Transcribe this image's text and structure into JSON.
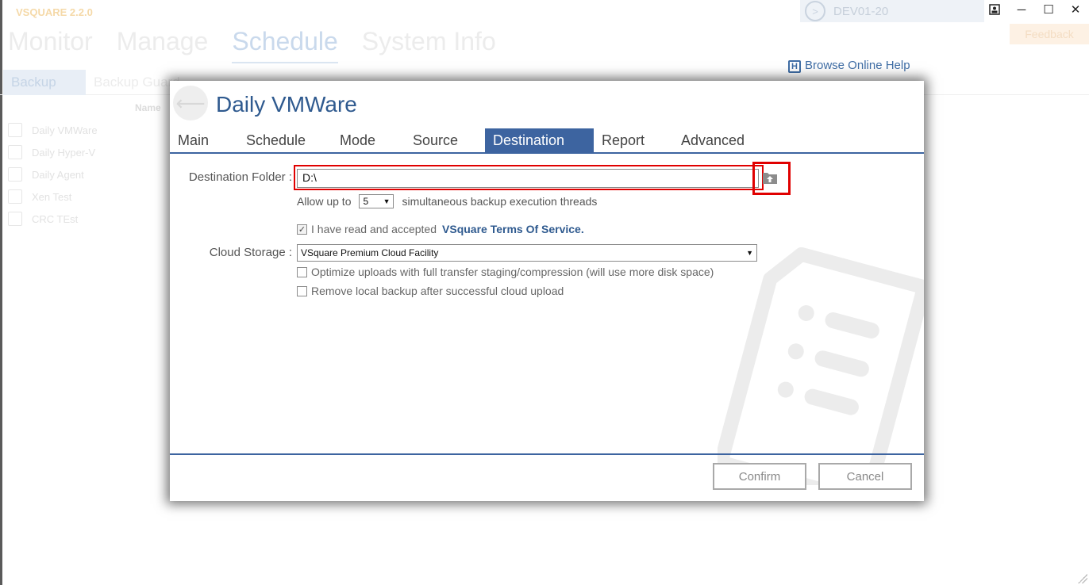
{
  "app": {
    "title": "VSQUARE 2.2.0",
    "title_rest": "",
    "server_label": "DEV01-20",
    "feedback_label": "Feedback",
    "top_nav": [
      "Monitor",
      "Manage",
      "Schedule",
      "System Info"
    ],
    "sub_nav": {
      "backup": "Backup",
      "guard": "Backup Guard"
    },
    "list_header": "Name",
    "jobs": [
      "Daily VMWare",
      "Daily Hyper-V",
      "Daily Agent",
      "Xen Test",
      "CRC TEst"
    ],
    "help_link": "Browse Online Help",
    "window_buttons": {
      "user": "user-icon",
      "minimize": "─",
      "maximize": "☐",
      "close": "✕"
    }
  },
  "dialog": {
    "title": "Daily VMWare",
    "tabs": [
      "Main",
      "Schedule",
      "Mode",
      "Source",
      "Destination",
      "Report",
      "Advanced"
    ],
    "active_tab": "Destination",
    "destination_label": "Destination Folder :",
    "destination_value": "D:\\",
    "allow_prefix": "Allow up to",
    "threads_value": "5",
    "threads_suffix": "simultaneous backup execution threads",
    "tos_checked": true,
    "tos_text": "I have read and accepted",
    "tos_link": "VSquare Terms Of Service.",
    "cloud_label": "Cloud Storage :",
    "cloud_value": "VSquare Premium Cloud Facility",
    "optimize_checked": false,
    "optimize_text": "Optimize uploads with full transfer staging/compression (will use more disk space)",
    "remove_checked": false,
    "remove_text": "Remove local backup after successful cloud upload",
    "confirm_label": "Confirm",
    "cancel_label": "Cancel"
  },
  "colors": {
    "accent": "#3d64a0",
    "title": "#2f5a8f",
    "highlight": "#e00000"
  }
}
